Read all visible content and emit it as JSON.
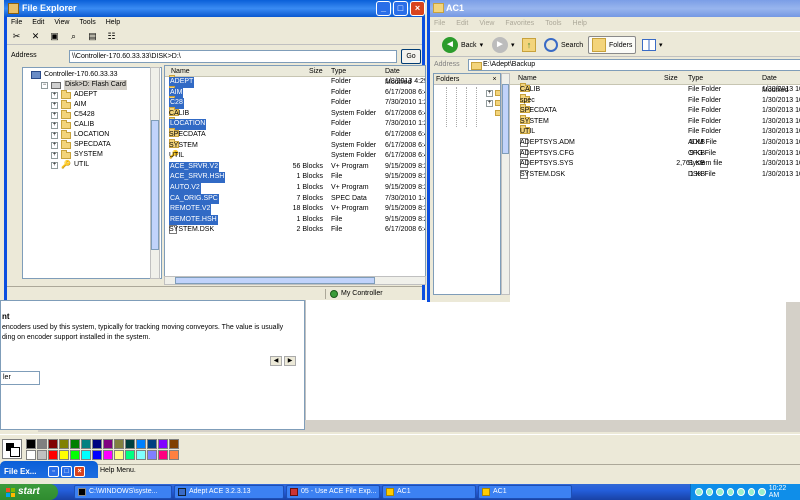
{
  "background": {
    "desc_heading": "nt",
    "desc_text": "encoders used by this system, typically for tracking moving conveyors. The value is usually ding on encoder support installed in the system.",
    "field_value": "ler",
    "status_help": "Help Menu.",
    "minimized_window_title": "File Ex..."
  },
  "palette": {
    "colors": [
      "#000000",
      "#808080",
      "#800000",
      "#808000",
      "#008000",
      "#008080",
      "#000080",
      "#800080",
      "#808040",
      "#004040",
      "#0080ff",
      "#004080",
      "#8000ff",
      "#804000",
      "#ffffff",
      "#c0c0c0",
      "#ff0000",
      "#ffff00",
      "#00ff00",
      "#00ffff",
      "#0000ff",
      "#ff00ff",
      "#ffff80",
      "#00ff80",
      "#80ffff",
      "#8080ff",
      "#ff0080",
      "#ff8040"
    ]
  },
  "taskbar": {
    "start_label": "start",
    "buttons": [
      {
        "label": "C:\\WINDOWS\\syste...",
        "icon": "cmd-icon"
      },
      {
        "label": "Adept ACE 3.2.3.13",
        "icon": "app-icon"
      },
      {
        "label": "05 - Use ACE File Exp...",
        "icon": "doc-icon"
      },
      {
        "label": "AC1",
        "icon": "folder-icon"
      },
      {
        "label": "AC1",
        "icon": "folder-icon"
      }
    ],
    "clock": "10:22 AM"
  },
  "file_explorer": {
    "title": "File Explorer",
    "menu": [
      "File",
      "Edit",
      "View",
      "Tools",
      "Help"
    ],
    "address_label": "Address",
    "address_value": "\\\\Controller-170.60.33.33\\DISK>D:\\",
    "go_label": "Go",
    "tree": [
      {
        "label": "Controller-170.60.33.33",
        "level": 0,
        "icon": "pc",
        "exp": ""
      },
      {
        "label": "Disk>D: Flash Card",
        "level": 1,
        "icon": "drive",
        "exp": "−",
        "selected": true
      },
      {
        "label": "ADEPT",
        "level": 2,
        "icon": "folder",
        "exp": "+"
      },
      {
        "label": "AIM",
        "level": 2,
        "icon": "folder",
        "exp": "+"
      },
      {
        "label": "C5428",
        "level": 2,
        "icon": "folder",
        "exp": "+"
      },
      {
        "label": "CALIB",
        "level": 2,
        "icon": "folder",
        "exp": "+"
      },
      {
        "label": "LOCATION",
        "level": 2,
        "icon": "folder",
        "exp": "+"
      },
      {
        "label": "SPECDATA",
        "level": 2,
        "icon": "folder",
        "exp": "+"
      },
      {
        "label": "SYSTEM",
        "level": 2,
        "icon": "folder",
        "exp": "+"
      },
      {
        "label": "UTIL",
        "level": 2,
        "icon": "key",
        "exp": "+"
      }
    ],
    "columns": [
      "Name",
      "Size",
      "Type",
      "Date Modified"
    ],
    "files": [
      {
        "name": "ADEPT",
        "size": "",
        "type": "Folder",
        "date": "1/8/2013 4:29",
        "icon": "folder",
        "selected": true
      },
      {
        "name": "AIM",
        "size": "",
        "type": "Folder",
        "date": "6/17/2008 6:4",
        "icon": "folder",
        "selected": true
      },
      {
        "name": "C28",
        "size": "",
        "type": "Folder",
        "date": "7/30/2010 1:2",
        "icon": "folder",
        "selected": true
      },
      {
        "name": "CALIB",
        "size": "",
        "type": "System Folder",
        "date": "6/17/2008 6:4",
        "icon": "folder",
        "selected": false
      },
      {
        "name": "LOCATION",
        "size": "",
        "type": "Folder",
        "date": "7/30/2010 1:2",
        "icon": "folder",
        "selected": true
      },
      {
        "name": "SPECDATA",
        "size": "",
        "type": "Folder",
        "date": "6/17/2008 6:4",
        "icon": "folder",
        "selected": false
      },
      {
        "name": "SYSTEM",
        "size": "",
        "type": "System Folder",
        "date": "6/17/2008 6:4",
        "icon": "folder",
        "selected": false
      },
      {
        "name": "UTIL",
        "size": "",
        "type": "System Folder",
        "date": "6/17/2008 6:4",
        "icon": "key",
        "selected": false
      },
      {
        "name": "ACE_SRVR.V2",
        "size": "56 Blocks",
        "type": "V+ Program",
        "date": "9/15/2009 8:2",
        "icon": "file",
        "selected": true
      },
      {
        "name": "ACE_SRVR.HSH",
        "size": "1 Blocks",
        "type": "File",
        "date": "9/15/2009 8:2",
        "icon": "file",
        "selected": true
      },
      {
        "name": "AUTO.V2",
        "size": "1 Blocks",
        "type": "V+ Program",
        "date": "9/15/2009 8:2",
        "icon": "file",
        "selected": true
      },
      {
        "name": "CA_ORIG.SPC",
        "size": "7 Blocks",
        "type": "SPEC Data",
        "date": "7/30/2010 1:4",
        "icon": "file",
        "selected": true
      },
      {
        "name": "REMOTE.V2",
        "size": "18 Blocks",
        "type": "V+ Program",
        "date": "9/15/2009 8:2",
        "icon": "file",
        "selected": true
      },
      {
        "name": "REMOTE.HSH",
        "size": "1 Blocks",
        "type": "File",
        "date": "9/15/2009 8:2",
        "icon": "file",
        "selected": true
      },
      {
        "name": "SYSTEM.DSK",
        "size": "2 Blocks",
        "type": "File",
        "date": "6/17/2008 6:4",
        "icon": "file",
        "selected": false
      }
    ],
    "status_right": "My Controller"
  },
  "ac1": {
    "title": "AC1",
    "menu": [
      "File",
      "Edit",
      "View",
      "Favorites",
      "Tools",
      "Help"
    ],
    "toolbar": {
      "back": "Back",
      "search": "Search",
      "folders": "Folders"
    },
    "address_label": "Address",
    "address_value": "E:\\Adept\\Backup",
    "folders_header": "Folders",
    "columns": [
      "Name",
      "Size",
      "Type",
      "Date Modified"
    ],
    "files": [
      {
        "name": "CALIB",
        "size": "",
        "type": "File Folder",
        "date": "1/30/2013 10",
        "icon": "folder"
      },
      {
        "name": "spec",
        "size": "",
        "type": "File Folder",
        "date": "1/30/2013 10",
        "icon": "folder"
      },
      {
        "name": "SPECDATA",
        "size": "",
        "type": "File Folder",
        "date": "1/30/2013 10",
        "icon": "folder"
      },
      {
        "name": "SYSTEM",
        "size": "",
        "type": "File Folder",
        "date": "1/30/2013 10",
        "icon": "folder"
      },
      {
        "name": "UTIL",
        "size": "",
        "type": "File Folder",
        "date": "1/30/2013 10",
        "icon": "folder"
      },
      {
        "name": "ADEPTSYS.ADM",
        "size": "5 KB",
        "type": "ADM File",
        "date": "1/30/2013 10",
        "icon": "file"
      },
      {
        "name": "ADEPTSYS.CFG",
        "size": "9 KB",
        "type": "CFG File",
        "date": "1/30/2013 10",
        "icon": "file"
      },
      {
        "name": "ADEPTSYS.SYS",
        "size": "2,761 KB",
        "type": "System file",
        "date": "1/30/2013 10",
        "icon": "file"
      },
      {
        "name": "SYSTEM.DSK",
        "size": "1 KB",
        "type": "DSK File",
        "date": "1/30/2013 10",
        "icon": "file"
      }
    ]
  }
}
